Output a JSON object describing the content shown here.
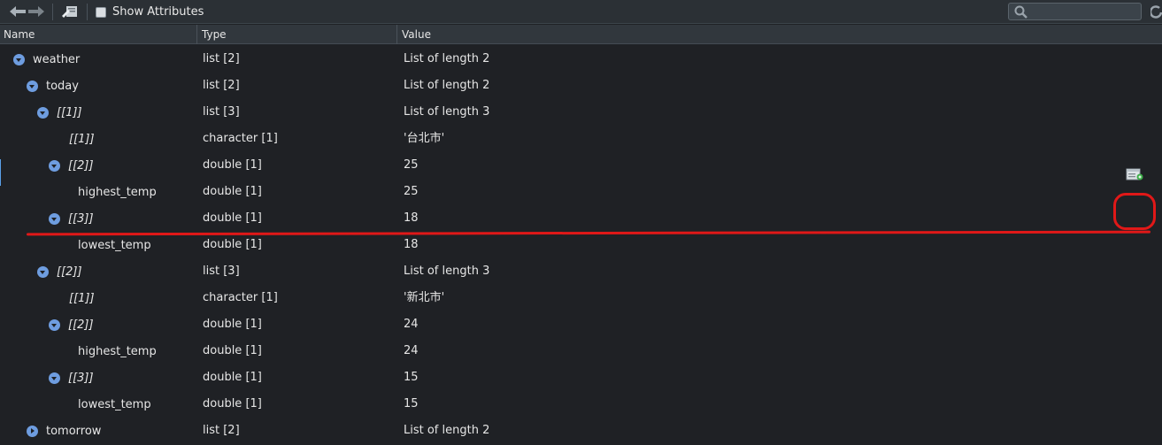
{
  "toolbar": {
    "show_attributes_label": "Show Attributes",
    "show_attributes_checked": false,
    "search_placeholder": ""
  },
  "columns": {
    "name": "Name",
    "type": "Type",
    "value": "Value"
  },
  "rows": [
    {
      "name": "weather",
      "type": "list [2]",
      "value": "List of length 2",
      "toggle": "expanded",
      "italic": false
    },
    {
      "name": "today",
      "type": "list [2]",
      "value": "List of length 2",
      "toggle": "expanded",
      "italic": false
    },
    {
      "name": "[[1]]",
      "type": "list [3]",
      "value": "List of length 3",
      "toggle": "expanded",
      "italic": true
    },
    {
      "name": "[[1]]",
      "type": "character [1]",
      "value": "'台北市'",
      "toggle": "none",
      "italic": true
    },
    {
      "name": "[[2]]",
      "type": "double [1]",
      "value": "25",
      "toggle": "expanded",
      "italic": true
    },
    {
      "name": "highest_temp",
      "type": "double [1]",
      "value": "25",
      "toggle": "none",
      "italic": false
    },
    {
      "name": "[[3]]",
      "type": "double [1]",
      "value": "18",
      "toggle": "expanded",
      "italic": true
    },
    {
      "name": "lowest_temp",
      "type": "double [1]",
      "value": "18",
      "toggle": "none",
      "italic": false
    },
    {
      "name": "[[2]]",
      "type": "list [3]",
      "value": "List of length 3",
      "toggle": "expanded",
      "italic": true
    },
    {
      "name": "[[1]]",
      "type": "character [1]",
      "value": "'新北市'",
      "toggle": "none",
      "italic": true
    },
    {
      "name": "[[2]]",
      "type": "double [1]",
      "value": "24",
      "toggle": "expanded",
      "italic": true
    },
    {
      "name": "highest_temp",
      "type": "double [1]",
      "value": "24",
      "toggle": "none",
      "italic": false
    },
    {
      "name": "[[3]]",
      "type": "double [1]",
      "value": "15",
      "toggle": "expanded",
      "italic": true
    },
    {
      "name": "lowest_temp",
      "type": "double [1]",
      "value": "15",
      "toggle": "none",
      "italic": false
    },
    {
      "name": "tomorrow",
      "type": "list [2]",
      "value": "List of length 2",
      "toggle": "collapsed",
      "italic": false
    }
  ],
  "icons": {
    "back": "back-arrow-icon",
    "forward": "forward-arrow-icon",
    "open_in_editor": "open-in-editor-icon",
    "search": "search-icon",
    "refresh": "refresh-icon",
    "copy_code": "copy-code-icon"
  },
  "colors": {
    "background": "#1f2125",
    "toolbar": "#2b3035",
    "toggle": "#6e9de0",
    "annotation": "#e01818"
  }
}
